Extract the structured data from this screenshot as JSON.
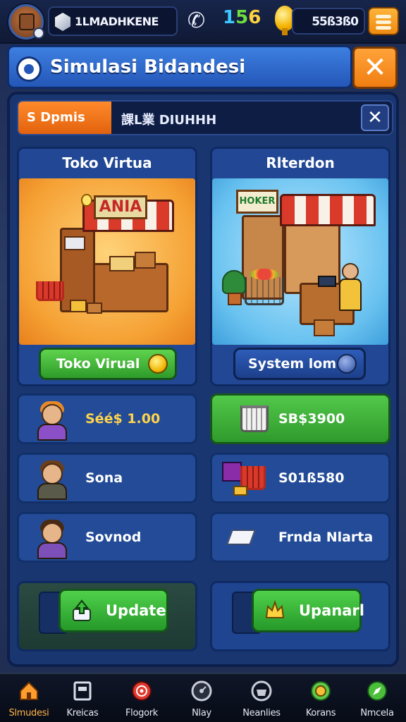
{
  "topbar": {
    "player_name": "1LMADHKENE",
    "score": [
      "1",
      "5",
      "6"
    ],
    "coins": "55ß3ß0"
  },
  "header": {
    "title": "Simulasi Bidandesi"
  },
  "tabs": {
    "active_label": "S Dpmis",
    "title": "課L業 DIUHHH"
  },
  "cards": [
    {
      "title": "Toko Virtua",
      "sign": "ANIA",
      "button": "Toko Virual"
    },
    {
      "title": "Rlterdon",
      "sign": "HOKER",
      "button": "System lom"
    }
  ],
  "rows_left": [
    {
      "label": "Séé$ 1.00"
    },
    {
      "label": "Sona"
    },
    {
      "label": "Sovnod"
    }
  ],
  "rows_right": [
    {
      "label": "SB$3900"
    },
    {
      "label": "S01ß580"
    },
    {
      "label": "Frnda Nlarta"
    }
  ],
  "actions": [
    {
      "label": "Update"
    },
    {
      "label": "Upanarl"
    }
  ],
  "nav": [
    {
      "label": "Slmudesi",
      "icon": "home-icon",
      "color": "#ff9d2e"
    },
    {
      "label": "Kreicas",
      "icon": "tray-icon",
      "color": "#d9dde8"
    },
    {
      "label": "Flogork",
      "icon": "target-icon",
      "color": "#e23a2e"
    },
    {
      "label": "Nlay",
      "icon": "dial-icon",
      "color": "#c9ccd6"
    },
    {
      "label": "Neanlies",
      "icon": "basket-icon",
      "color": "#c9ccd6"
    },
    {
      "label": "Korans",
      "icon": "coin-icon",
      "color": "#5ec94a"
    },
    {
      "label": "Nmcela",
      "icon": "compass-icon",
      "color": "#4cbf3a"
    }
  ]
}
